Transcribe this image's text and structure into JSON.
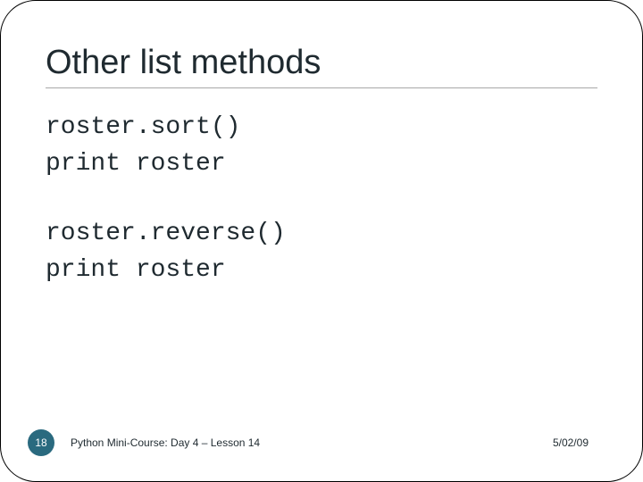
{
  "title": "Other list methods",
  "code": {
    "block1_line1": "roster.sort()",
    "block1_line2": "print roster",
    "block2_line1": "roster.reverse()",
    "block2_line2": "print roster"
  },
  "footer": {
    "page": "18",
    "course": "Python Mini-Course: Day 4 – Lesson 14",
    "date": "5/02/09"
  }
}
